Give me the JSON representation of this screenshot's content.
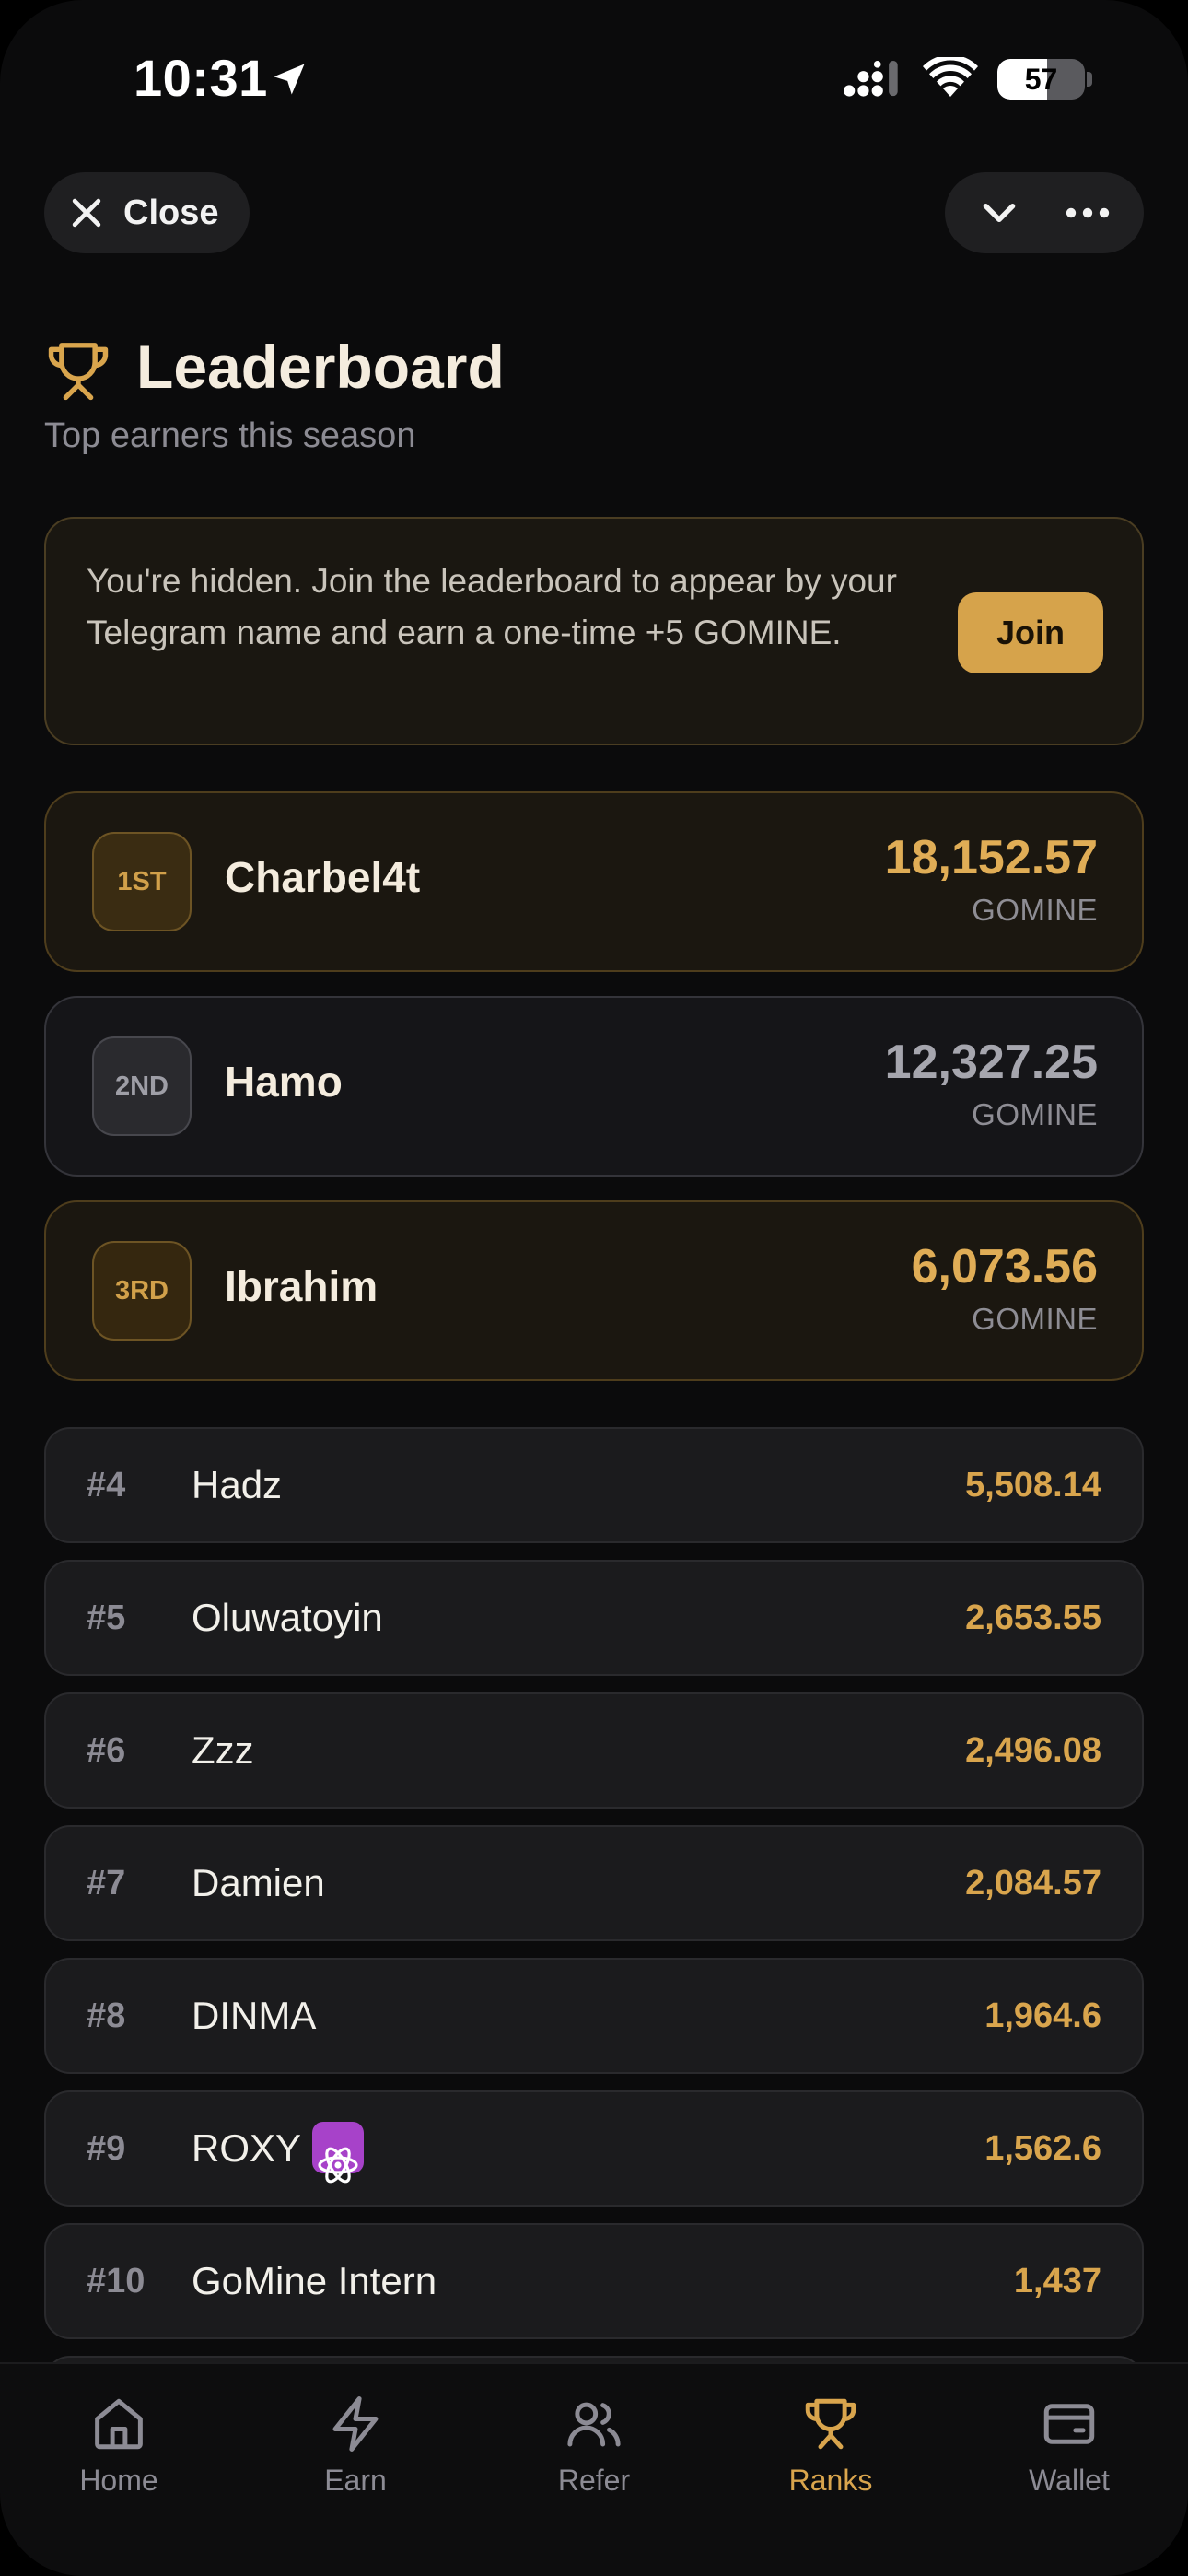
{
  "status_bar": {
    "time": "10:31",
    "battery": "57",
    "battery_level": 0.57
  },
  "top_bar": {
    "close_label": "Close"
  },
  "header": {
    "title": "Leaderboard",
    "subtitle": "Top earners this season"
  },
  "banner": {
    "text": "You're hidden. Join the leaderboard to appear by your Telegram name and earn a one-time +5 GOMINE.",
    "join_label": "Join"
  },
  "podium": [
    {
      "rank": "1ST",
      "name": "Charbel4t",
      "value": "18,152.57",
      "unit": "GOMINE"
    },
    {
      "rank": "2ND",
      "name": "Hamo",
      "value": "12,327.25",
      "unit": "GOMINE"
    },
    {
      "rank": "3RD",
      "name": "Ibrahim",
      "value": "6,073.56",
      "unit": "GOMINE"
    }
  ],
  "list": [
    {
      "rank": "#4",
      "name": "Hadz",
      "value": "5,508.14"
    },
    {
      "rank": "#5",
      "name": "Oluwatoyin",
      "value": "2,653.55"
    },
    {
      "rank": "#6",
      "name": "Zzz",
      "value": "2,496.08"
    },
    {
      "rank": "#7",
      "name": "Damien",
      "value": "2,084.57"
    },
    {
      "rank": "#8",
      "name": "DINMA",
      "value": "1,964.6"
    },
    {
      "rank": "#9",
      "name": "ROXY",
      "value": "1,562.6",
      "emoji": "atom-symbol-icon"
    },
    {
      "rank": "#10",
      "name": "GoMine Intern",
      "value": "1,437"
    }
  ],
  "tabs": [
    {
      "label": "Home",
      "icon": "home-icon"
    },
    {
      "label": "Earn",
      "icon": "lightning-icon"
    },
    {
      "label": "Refer",
      "icon": "users-icon"
    },
    {
      "label": "Ranks",
      "icon": "trophy-icon",
      "active": true
    },
    {
      "label": "Wallet",
      "icon": "wallet-icon"
    }
  ],
  "colors": {
    "accent": "#d9a54d",
    "background": "#0b0b0c",
    "muted": "#8c8b94"
  }
}
